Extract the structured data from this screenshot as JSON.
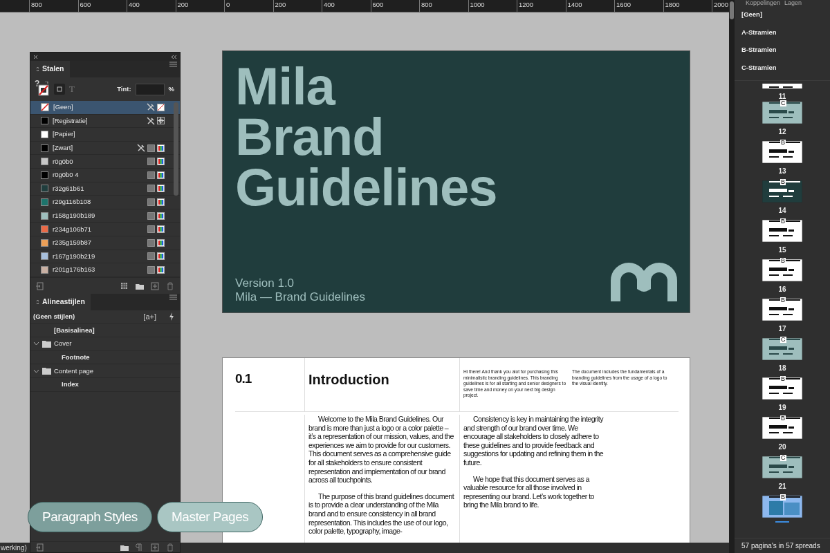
{
  "ruler": {
    "labels": [
      "800",
      "600",
      "400",
      "200",
      "0",
      "200",
      "400",
      "600",
      "800",
      "1000",
      "1200",
      "1400",
      "1600",
      "1800",
      "2000"
    ]
  },
  "swatches_panel": {
    "tab": "Stalen",
    "unknown_glyph": "?",
    "text_glyph": "T",
    "tint_label": "Tint:",
    "percent": "%",
    "swatches": [
      {
        "name": "[Geen]",
        "kind": "none",
        "locked": true,
        "selected": true
      },
      {
        "name": "[Registratie]",
        "kind": "registration",
        "color": "#000000",
        "locked": true,
        "selected": false
      },
      {
        "name": "[Papier]",
        "kind": "paper",
        "color": "#ffffff",
        "locked": false,
        "selected": false
      },
      {
        "name": "[Zwart]",
        "kind": "process",
        "color": "#000000",
        "locked": true,
        "selected": false
      },
      {
        "name": "r0g0b0",
        "kind": "process",
        "color": "#c8c8c8",
        "locked": false,
        "selected": false
      },
      {
        "name": "r0g0b0 4",
        "kind": "process",
        "color": "#000000",
        "locked": false,
        "selected": false
      },
      {
        "name": "r32g61b61",
        "kind": "process",
        "color": "#203d3d",
        "locked": false,
        "selected": false
      },
      {
        "name": "r29g116b108",
        "kind": "process",
        "color": "#1d746c",
        "locked": false,
        "selected": false
      },
      {
        "name": "r158g190b189",
        "kind": "process",
        "color": "#9ebebd",
        "locked": false,
        "selected": false
      },
      {
        "name": "r234g106b71",
        "kind": "process",
        "color": "#ea6a47",
        "locked": false,
        "selected": false
      },
      {
        "name": "r235g159b87",
        "kind": "process",
        "color": "#eb9f57",
        "locked": false,
        "selected": false
      },
      {
        "name": "r167g190b219",
        "kind": "process",
        "color": "#a7bedb",
        "locked": false,
        "selected": false
      },
      {
        "name": "r201g176b163",
        "kind": "process",
        "color": "#c9b0a3",
        "locked": false,
        "selected": false
      }
    ]
  },
  "paragraph_styles_panel": {
    "tab": "Alineastijlen",
    "header": "(Geen stijlen)",
    "new_style_glyph": "[a+]",
    "styles": [
      {
        "name": "[Basisalinea]",
        "kind": "style"
      },
      {
        "name": "Cover",
        "kind": "group",
        "expanded": true,
        "children": [
          {
            "name": "Footnote",
            "kind": "style"
          }
        ]
      },
      {
        "name": "Content page",
        "kind": "group",
        "expanded": true,
        "children": [
          {
            "name": "Index",
            "kind": "style"
          }
        ]
      }
    ]
  },
  "cover_page": {
    "title_lines": [
      "Mila",
      "Brand",
      "Guidelines"
    ],
    "version": "Version 1.0",
    "subtitle": "Mila — Brand Guidelines"
  },
  "intro_page": {
    "number": "0.1",
    "heading": "Introduction",
    "notes": [
      "Hi there! And thank you alot for purchasing this minimalistic branding guidelines. This branding guidelines is for all starting and senior designers to save time and money on your next big design project.",
      "The document includes the fundamentals of a branding guidelines from the usage of a logo to the visual identity."
    ],
    "columns": [
      [
        "Welcome to the Mila Brand Guidelines. Our brand is more than just a logo or a color palette – it’s a representation of our mission, values, and the experiences we aim to provide for our customers. This document serves as a comprehensive guide for all stakeholders to ensure consistent representation and implementation of our brand across all touchpoints.",
        "The purpose of this brand guidelines document is to provide a clear understanding of the Mila brand and to ensure consistency in all brand representation. This includes the use of our logo, color palette, typography, image-"
      ],
      [
        "Consistency is key in maintaining the integrity and strength of our brand over time. We encourage all stakeholders to closely adhere to these guidelines and to provide feedback and suggestions for updating and refining them in the future.",
        "We hope that this document serves as a valuable resource for all those involved in representing our brand. Let’s work together to bring the Mila brand to life."
      ]
    ]
  },
  "overlay_buttons": [
    "Paragraph Styles",
    "Master Pages"
  ],
  "pages_panel": {
    "tabs": [
      "Koppelingen",
      "Lagen"
    ],
    "masters": [
      "[Geen]",
      "A-Stramien",
      "B-Stramien",
      "C-Stramien"
    ],
    "pages": [
      {
        "number": "11",
        "kind": "white",
        "selected": false
      },
      {
        "number": "12",
        "master": "C",
        "kind": "section",
        "selected": false
      },
      {
        "number": "13",
        "master": "B",
        "kind": "white",
        "selected": false
      },
      {
        "number": "14",
        "master": "B",
        "kind": "dark",
        "selected": false
      },
      {
        "number": "15",
        "master": "B",
        "kind": "white",
        "selected": false
      },
      {
        "number": "16",
        "master": "B",
        "kind": "white",
        "selected": false
      },
      {
        "number": "17",
        "master": "B",
        "kind": "white",
        "selected": false
      },
      {
        "number": "18",
        "master": "C",
        "kind": "section",
        "selected": false
      },
      {
        "number": "19",
        "master": "B",
        "kind": "white",
        "selected": false
      },
      {
        "number": "20",
        "master": "B",
        "kind": "white",
        "selected": false
      },
      {
        "number": "21",
        "master": "C",
        "kind": "section",
        "selected": false
      },
      {
        "master": "B",
        "kind": "white",
        "selected": true
      }
    ],
    "footer": "57 pagina's in 57 spreads"
  },
  "status_bar": {
    "text": "werking)"
  }
}
